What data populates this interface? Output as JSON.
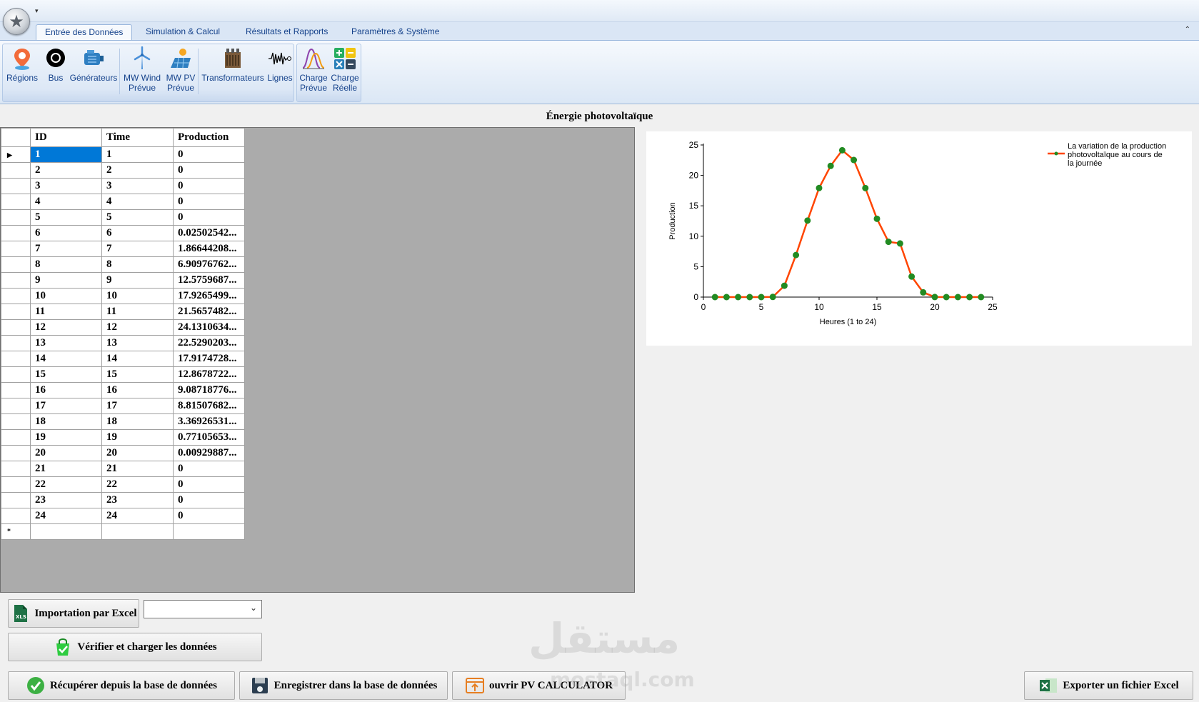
{
  "ribbon": {
    "tabs": [
      {
        "label": "Entrée des Données"
      },
      {
        "label": "Simulation & Calcul"
      },
      {
        "label": "Résultats et Rapports"
      },
      {
        "label": "Paramètres & Système"
      }
    ],
    "buttons": {
      "regions": {
        "label": "Régions",
        "icon": "map-pin-icon"
      },
      "bus": {
        "label": "Bus",
        "icon": "bus-ring-icon"
      },
      "generateurs": {
        "label": "Générateurs",
        "icon": "generator-icon"
      },
      "mw_wind_1": {
        "label": "MW Wind"
      },
      "mw_wind_2": {
        "label": "Prévue"
      },
      "mw_pv_1": {
        "label": "MW PV"
      },
      "mw_pv_2": {
        "label": "Prévue"
      },
      "transformateurs": {
        "label": "Transformateurs",
        "icon": "transformer-icon"
      },
      "lignes": {
        "label": "Lignes",
        "icon": "waveform-icon"
      },
      "charge_prevue_1": {
        "label": "Charge"
      },
      "charge_prevue_2": {
        "label": "Prévue"
      },
      "charge_reelle_1": {
        "label": "Charge"
      },
      "charge_reelle_2": {
        "label": "Réelle"
      }
    }
  },
  "section_title": "Énergie photovoltaïque",
  "grid": {
    "columns": [
      "ID",
      "Time",
      "Production"
    ],
    "rows": [
      [
        "1",
        "1",
        "0"
      ],
      [
        "2",
        "2",
        "0"
      ],
      [
        "3",
        "3",
        "0"
      ],
      [
        "4",
        "4",
        "0"
      ],
      [
        "5",
        "5",
        "0"
      ],
      [
        "6",
        "6",
        "0.02502542..."
      ],
      [
        "7",
        "7",
        "1.86644208..."
      ],
      [
        "8",
        "8",
        "6.90976762..."
      ],
      [
        "9",
        "9",
        "12.5759687..."
      ],
      [
        "10",
        "10",
        "17.9265499..."
      ],
      [
        "11",
        "11",
        "21.5657482..."
      ],
      [
        "12",
        "12",
        "24.1310634..."
      ],
      [
        "13",
        "13",
        "22.5290203..."
      ],
      [
        "14",
        "14",
        "17.9174728..."
      ],
      [
        "15",
        "15",
        "12.8678722..."
      ],
      [
        "16",
        "16",
        "9.08718776..."
      ],
      [
        "17",
        "17",
        "8.81507682..."
      ],
      [
        "18",
        "18",
        "3.36926531..."
      ],
      [
        "19",
        "19",
        "0.77105653..."
      ],
      [
        "20",
        "20",
        "0.00929887..."
      ],
      [
        "21",
        "21",
        "0"
      ],
      [
        "22",
        "22",
        "0"
      ],
      [
        "23",
        "23",
        "0"
      ],
      [
        "24",
        "24",
        "0"
      ]
    ],
    "new_row_marker": "*"
  },
  "chart_data": {
    "type": "line",
    "title": "",
    "xlabel": "Heures (1 to 24)",
    "ylabel": "Production",
    "xlim": [
      0,
      25
    ],
    "ylim": [
      0,
      25
    ],
    "xticks": [
      0,
      5,
      10,
      15,
      20,
      25
    ],
    "yticks": [
      0,
      5,
      10,
      15,
      20,
      25
    ],
    "grid": false,
    "legend_position": "top-right",
    "series": [
      {
        "name": "La variation de la production photovoltaïque au cours de la journée",
        "line_color": "#ff4500",
        "marker_color": "#228b22",
        "x": [
          1,
          2,
          3,
          4,
          5,
          6,
          7,
          8,
          9,
          10,
          11,
          12,
          13,
          14,
          15,
          16,
          17,
          18,
          19,
          20,
          21,
          22,
          23,
          24
        ],
        "values": [
          0,
          0,
          0,
          0,
          0,
          0.025,
          1.866,
          6.91,
          12.576,
          17.927,
          21.566,
          24.131,
          22.529,
          17.917,
          12.868,
          9.087,
          8.815,
          3.369,
          0.771,
          0.009,
          0,
          0,
          0,
          0
        ]
      }
    ],
    "legend_lines": [
      "La variation de la production",
      "photovoltaïque au cours de",
      "la journée"
    ]
  },
  "buttons": {
    "import_excel": "Importation par Excel",
    "verify": "Vérifier et charger les données",
    "recuperer": "Récupérer depuis la base de données",
    "enregistrer": "Enregistrer dans la base de données",
    "pv_calculator": "ouvrir PV CALCULATOR",
    "exporter": "Exporter un fichier Excel"
  },
  "combo": {
    "value": ""
  },
  "watermark": {
    "line1": "مستقل",
    "line2": "mostaql.com"
  }
}
